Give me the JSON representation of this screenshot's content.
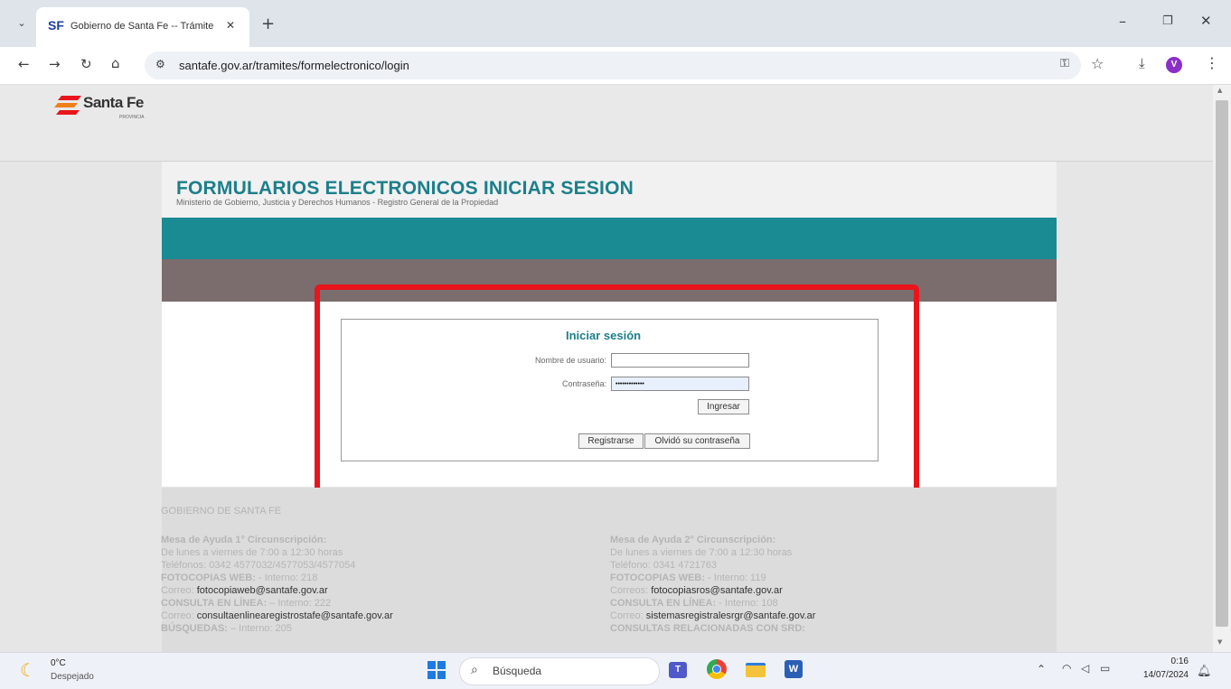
{
  "browser": {
    "tab_favicon": "SF",
    "tab_title": "Gobierno de Santa Fe -- Trámite",
    "tab_close": "✕",
    "new_tab": "+",
    "url": "santafe.gov.ar/tramites/formelectronico/login",
    "profile_initial": "V"
  },
  "site": {
    "logo_text": "Santa Fe",
    "logo_sub": "PROVINCIA",
    "title": "FORMULARIOS ELECTRONICOS INICIAR SESION",
    "subtitle": "Ministerio de Gobierno, Justicia y Derechos Humanos - Registro General de la Propiedad",
    "teal_color": "#1a8a93",
    "grey_band_color": "#7b6d6d",
    "highlight_color": "#e8151b"
  },
  "login": {
    "heading": "Iniciar sesión",
    "username_label": "Nombre de usuario:",
    "username_value": "",
    "password_label": "Contraseña:",
    "password_value": "•••••••••••••",
    "submit_label": "Ingresar",
    "register_label": "Registrarse",
    "forgot_label": "Olvidó su contraseña"
  },
  "footer": {
    "heading": "GOBIERNO DE SANTA FE",
    "col1": {
      "title": "Mesa de Ayuda 1° Circunscripción:",
      "hours": "De lunes a viernes de 7:00 a 12:30 horas",
      "phones": "Teléfonos: 0342 4577032/4577053/4577054",
      "fotocopias_label": "FOTOCOPIAS WEB:",
      "fotocopias_int": " - Interno: 218",
      "correo1_label": "Correo:",
      "correo1": "fotocopiaweb@santafe.gov.ar",
      "consulta_label": "CONSULTA EN LÍNEA:",
      "consulta_int": " – Interno: 222",
      "correo2_label": "Correo:",
      "correo2": "consultaenlinearegistrostafe@santafe.gov.ar",
      "busquedas_label": "BÚSQUEDAS:",
      "busquedas_int": " – Interno: 205"
    },
    "col2": {
      "title": "Mesa de Ayuda 2° Circunscripción:",
      "hours": "De lunes a viernes de 7:00 a 12:30 horas",
      "phones": "Teléfono: 0341 4721763",
      "fotocopias_label": "FOTOCOPIAS WEB:",
      "fotocopias_int": " - Interno: 119",
      "correo1_label": "Correos:",
      "correo1": "fotocopiasros@santafe.gov.ar",
      "consulta_label": "CONSULTA EN LÍNEA:",
      "consulta_int": " - Interno: 108",
      "correo2_label": "Correo:",
      "correo2": "sistemasregistralesrgr@santafe.gov.ar",
      "relacionadas_label": "CONSULTAS RELACIONADAS CON SRD:"
    }
  },
  "taskbar": {
    "weather_temp": "0°C",
    "weather_desc": "Despejado",
    "search_placeholder": "Búsqueda",
    "time": "0:16",
    "date": "14/07/2024"
  },
  "icons": [
    "chevron-down-icon",
    "favicon-icon",
    "back-icon",
    "forward-icon",
    "reload-icon",
    "home-icon",
    "site-settings-icon",
    "password-key-icon",
    "bookmark-star-icon",
    "download-icon",
    "menu-icon",
    "minimize-icon",
    "restore-icon",
    "close-icon",
    "scroll-up-icon",
    "scroll-down-icon",
    "weather-moon-icon",
    "windows-start-icon",
    "search-icon",
    "teams-icon",
    "chrome-icon",
    "file-explorer-icon",
    "word-icon",
    "chevron-up-icon",
    "wifi-icon",
    "volume-icon",
    "battery-icon",
    "notification-bell-icon"
  ]
}
